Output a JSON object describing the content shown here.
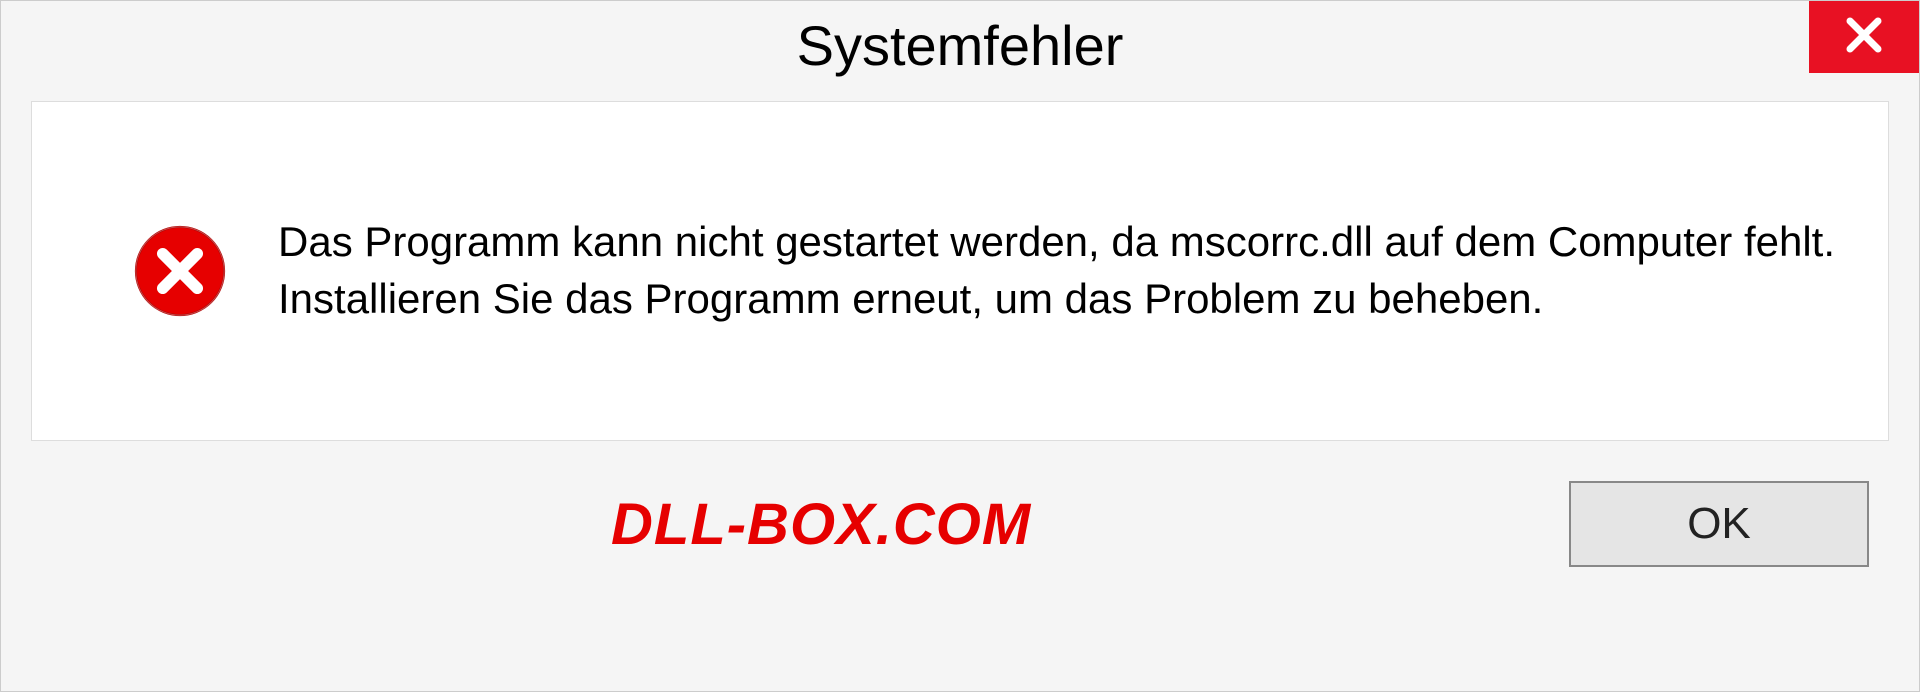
{
  "dialog": {
    "title": "Systemfehler",
    "message": "Das Programm kann nicht gestartet werden, da mscorrc.dll auf dem Computer fehlt. Installieren Sie das Programm erneut, um das Problem zu beheben.",
    "ok_label": "OK",
    "watermark": "DLL-BOX.COM"
  }
}
